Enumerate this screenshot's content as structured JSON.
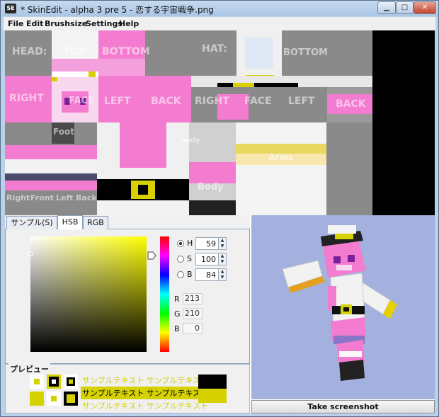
{
  "window": {
    "title": "* SkinEdit - alpha 3 pre 5 - 恋する宇宙戦争.png",
    "app_icon": "SE",
    "controls": [
      "minimize-icon",
      "maximize-icon",
      "close-icon"
    ]
  },
  "menubar": {
    "items": [
      "File",
      "Edit",
      "Brushsize",
      "Settings",
      "Help"
    ]
  },
  "texture_labels": {
    "head": "HEAD:",
    "top": "TOP",
    "bottom": "BOTTOM",
    "hat": "HAT:",
    "hat_bottom": "BOTTOM",
    "right": "RIGHT",
    "face": "FACE",
    "left": "LEFT",
    "back": "BACK",
    "hat_right": "RIGHT",
    "hat_face": "FACE",
    "hat_left": "LEFT",
    "hat_back": "BACK",
    "foot": "Foot",
    "body": "body",
    "arms": "Arms",
    "body_big": "Body",
    "leg_right": "Right",
    "leg_front": "Front",
    "leg_left": "Left",
    "leg_back": "Back"
  },
  "tabs": {
    "items": [
      "サンプル(S)",
      "HSB",
      "RGB"
    ],
    "active": "HSB"
  },
  "hsb": {
    "h_label": "H",
    "h_value": "59",
    "s_label": "S",
    "s_value": "100",
    "b_label": "B",
    "b_value": "84"
  },
  "rgb": {
    "r_label": "R",
    "r_value": "213",
    "g_label": "G",
    "g_value": "210",
    "b_label": "B",
    "b_value": "0"
  },
  "preview": {
    "title": "プレビュー",
    "sample_text_1": "サンプルテキスト サンプルテキスト",
    "sample_text_2": "サンプルテキスト サンプルテキスト",
    "sample_text_3": "サンプルテキスト サンプルテキスト"
  },
  "colors": {
    "selected": "#d5d200",
    "viewer_bg": "#a4b0dd",
    "skin_pink": "#f47cd0"
  },
  "screenshot_button": {
    "label": "Take screenshot"
  }
}
